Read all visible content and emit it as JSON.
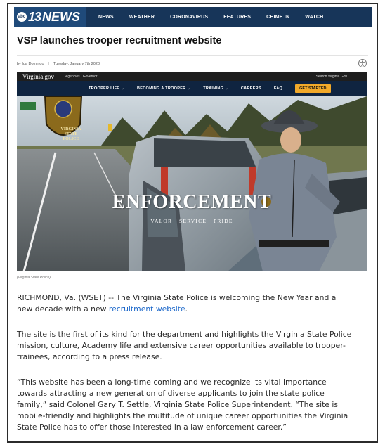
{
  "header": {
    "logo_abc": "abc",
    "logo_number": "13",
    "logo_news": "NEWS",
    "nav": [
      "NEWS",
      "WEATHER",
      "CORONAVIRUS",
      "FEATURES",
      "CHIME IN",
      "WATCH"
    ]
  },
  "article": {
    "title": "VSP launches trooper recruitment website",
    "author": "by Ida Domingo",
    "date": "Tuesday, January 7th 2020",
    "caption": "(Virginia State Police)",
    "p1_before": "RICHMOND, Va. (WSET) -- The Virginia State Police is welcoming the New Year and a new decade with a new ",
    "p1_link": "recruitment website",
    "p1_after": ".",
    "p2": "The site is the first of its kind for the department and highlights the Virginia State Police mission, culture, Academy life and extensive career opportunities available to trooper-trainees, according to a press release.",
    "p3": "“This website has been a long-time coming and we recognize its vital importance towards attracting a new generation of diverse applicants to join the state police family,” said Colonel Gary T. Settle, Virginia State Police Superintendent. “The site is mobile-friendly and highlights the multitude of unique career opportunities the Virginia State Police has to offer those interested in a law enforcement career.”"
  },
  "hero": {
    "site_bar": {
      "brand": "Virginia.gov",
      "links": "Agencies | Governor",
      "search": "Search Virginia.Gov"
    },
    "site_nav": [
      "TROOPER LIFE ⌄",
      "BECOMING A TROOPER ⌄",
      "TRAINING ⌄",
      "CAREERS",
      "FAQ"
    ],
    "cta": "GET STARTED",
    "badge_line1": "VIRGINIA",
    "badge_line2": "STATE",
    "badge_line3": "POLICE",
    "headline": "ENFORCEMENT",
    "tagline": "VALOR · SERVICE · PRIDE"
  },
  "colors": {
    "nav_bg": "#173559",
    "site_nav_bg": "#0f2440",
    "cta": "#f1a92a",
    "link": "#1a66c9"
  }
}
